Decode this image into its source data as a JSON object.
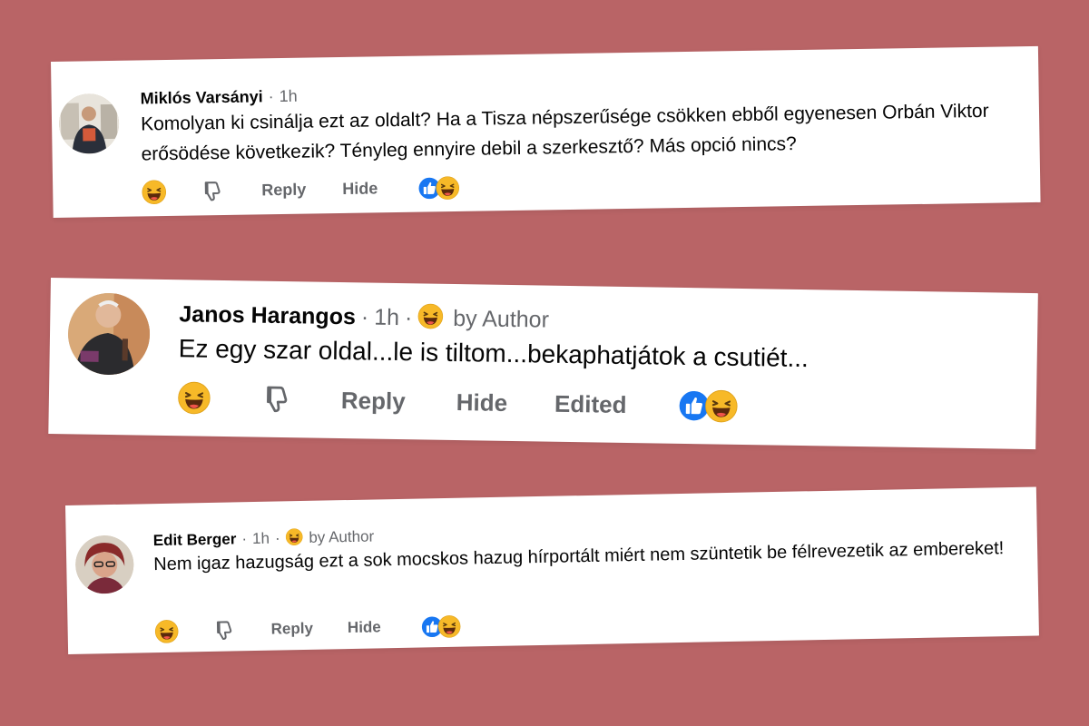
{
  "comments": [
    {
      "author": "Miklós Varsányi",
      "time": "1h",
      "badge": "",
      "text": "Komolyan ki csinálja ezt az oldalt? Ha a Tisza népszerűsége csökken ebből egyenesen Orbán Viktor erősödése következik? Tényleg ennyire debil a szerkesztő? Más opció nincs?",
      "reply_label": "Reply",
      "hide_label": "Hide",
      "edited_label": "",
      "reactions": [
        "like-icon",
        "laughing-emoji-icon"
      ]
    },
    {
      "author": "Janos Harangos",
      "time": "1h",
      "badge": "by Author",
      "text": "Ez egy szar oldal...le is tiltom...bekaphatjátok a csutiét...",
      "reply_label": "Reply",
      "hide_label": "Hide",
      "edited_label": "Edited",
      "reactions": [
        "like-icon",
        "laughing-emoji-icon"
      ]
    },
    {
      "author": "Edit Berger",
      "time": "1h",
      "badge": "by Author",
      "text": "Nem igaz hazugság ezt a sok mocskos hazug hírportált miért nem szüntetik be félrevezetik az embereket!",
      "reply_label": "Reply",
      "hide_label": "Hide",
      "edited_label": "",
      "reactions": [
        "like-icon",
        "laughing-emoji-icon"
      ]
    }
  ],
  "colors": {
    "background": "#b96466",
    "card": "#ffffff",
    "secondary_text": "#65676b",
    "like_blue": "#1877f2",
    "emoji_yellow": "#f7b928"
  }
}
